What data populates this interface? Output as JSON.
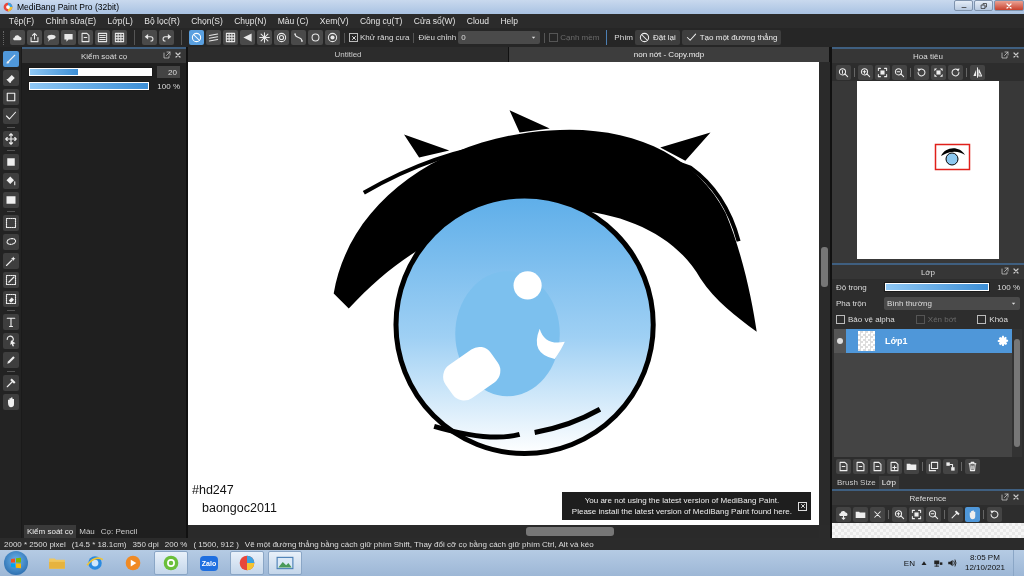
{
  "window": {
    "title": "MediBang Paint Pro (32bit)"
  },
  "menu": [
    "Tệp(F)",
    "Chỉnh sửa(E)",
    "Lớp(L)",
    "Bộ lọc(R)",
    "Chọn(S)",
    "Chụp(N)",
    "Màu (C)",
    "Xem(V)",
    "Công cụ(T)",
    "Cửa sổ(W)",
    "Cloud",
    "Help"
  ],
  "toolbar": {
    "snap_modes": [
      {
        "selected": true
      },
      {
        "selected": false
      },
      {
        "selected": false
      },
      {
        "selected": false
      },
      {
        "selected": false
      },
      {
        "selected": false
      },
      {
        "selected": false
      },
      {
        "selected": false
      },
      {
        "selected": false
      }
    ],
    "antialias": {
      "label": "Khử răng cưa",
      "checked": true
    },
    "correction": {
      "label": "Điều chỉnh",
      "value": "0"
    },
    "soft_edge": {
      "label": "Cạnh mềm",
      "checked": false,
      "disabled": true
    },
    "keys_label": "Phím",
    "reset": "Đặt lại",
    "straight_line": "Tạo một đường thẳng"
  },
  "tools": [
    {
      "selected": true
    },
    {
      "selected": false
    },
    {
      "selected": false
    },
    {
      "selected": false
    },
    {
      "selected": false
    },
    {
      "selected": false
    },
    {
      "selected": false
    },
    {
      "selected": false
    },
    {
      "selected": false
    },
    {
      "selected": false
    },
    {
      "selected": false
    },
    {
      "selected": false
    },
    {
      "selected": false
    },
    {
      "selected": false
    },
    {
      "selected": false
    },
    {
      "selected": false
    },
    {
      "selected": false
    },
    {
      "selected": false
    }
  ],
  "brush_panel": {
    "title": "Kiểm soát cọ",
    "size": {
      "level": 0.4,
      "value": "20"
    },
    "opacity": {
      "level": 1,
      "reading": "100 %"
    },
    "tabs": [
      {
        "label": "Kiểm soát cọ",
        "selected": true
      },
      {
        "label": "Màu",
        "selected": false
      },
      {
        "label": "Cọ: Pencil",
        "selected": false
      }
    ]
  },
  "canvas": {
    "tabs": [
      {
        "label": "Untitled",
        "selected": false
      },
      {
        "label": "non nớt - Copy.mdp",
        "selected": true
      }
    ],
    "texts": [
      "#hd247",
      "baongoc2011"
    ],
    "notice": {
      "lines": [
        "You are not using the latest version of MediBang Paint.",
        "Please install the latest version of MediBang Paint found here."
      ]
    }
  },
  "navigator": {
    "title": "Hoa tiêu"
  },
  "layers": {
    "title": "Lớp",
    "opacity": {
      "label": "Độ trong",
      "level": 1,
      "reading": "100 %"
    },
    "blend": {
      "label": "Pha trộn",
      "value": "Bình thường"
    },
    "options": [
      {
        "label": "Bảo vệ alpha",
        "checked": false,
        "disabled": false
      },
      {
        "label": "Xén bớt",
        "checked": false,
        "disabled": true
      },
      {
        "label": "Khóa",
        "checked": false,
        "disabled": false
      }
    ],
    "items": [
      {
        "name": "Lớp1",
        "visible": true,
        "selected": true
      }
    ],
    "tabs": [
      {
        "label": "Brush Size",
        "selected": false
      },
      {
        "label": "Lớp",
        "selected": true
      }
    ]
  },
  "reference": {
    "title": "Reference",
    "tools": [
      {
        "selected": false
      },
      {
        "selected": false
      },
      {
        "selected": false
      },
      {
        "selected": false
      },
      {
        "selected": false
      },
      {
        "selected": false
      },
      {
        "selected": false
      },
      {
        "selected": true
      },
      {
        "selected": false
      }
    ]
  },
  "status_bar": [
    "2000 * 2500 pixel",
    "(14.5 * 18.1cm)",
    "350 dpi",
    "200 %",
    "( 1500, 912 )",
    "Vẽ một đường thẳng bằng cách giữ phím Shift, Thay đổi cỡ cọ bằng cách giữ phím Ctrl, Alt và kéo"
  ],
  "taskbar": {
    "apps": [
      {
        "active": false
      },
      {
        "active": false
      },
      {
        "active": false
      },
      {
        "active": true
      },
      {
        "active": false,
        "label": "Zalo"
      },
      {
        "active": true
      },
      {
        "active": true
      }
    ],
    "tray": {
      "language": "EN",
      "time": "8:05 PM",
      "date": "12/10/2021"
    }
  }
}
